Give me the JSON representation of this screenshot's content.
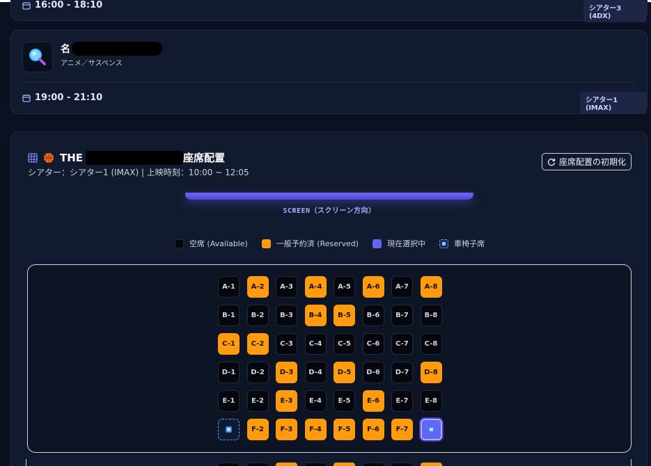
{
  "prev_showtime": {
    "time": "16:00 - 18:10",
    "theater": "シアター3 (4DX)"
  },
  "movie": {
    "icon": "magnifier-icon",
    "title_prefix": "名",
    "genre": "アニメ／サスペンス",
    "showtime": "19:00 - 21:10",
    "theater": "シアター1 (IMAX)"
  },
  "seatmap": {
    "icon_grid": "grid-icon",
    "icon_movie": "basketball-icon",
    "title_prefix": "THE",
    "title_suffix": "座席配置",
    "subtitle": "シアター：シアター1 (IMAX) | 上映時刻：10:00 ~ 12:05",
    "reset_label": "座席配置の初期化",
    "screen_label": "SCREEN（スクリーン方向）",
    "legend": [
      {
        "key": "available",
        "label": "空席 (Available)"
      },
      {
        "key": "reserved",
        "label": "一般予約済 (Reserved)"
      },
      {
        "key": "selected",
        "label": "現在選択中"
      },
      {
        "key": "wheelchair",
        "label": "車椅子席"
      }
    ],
    "colors": {
      "reserved": "#ff9b0f",
      "selected": "#6366f1",
      "available": "#05070d",
      "wheelchair": "#3b82f6"
    },
    "rows": [
      {
        "row": "A",
        "seats": [
          {
            "label": "A-1",
            "status": "available"
          },
          {
            "label": "A-2",
            "status": "reserved"
          },
          {
            "label": "A-3",
            "status": "available"
          },
          {
            "label": "A-4",
            "status": "reserved"
          },
          {
            "label": "A-5",
            "status": "available"
          },
          {
            "label": "A-6",
            "status": "reserved"
          },
          {
            "label": "A-7",
            "status": "available"
          },
          {
            "label": "A-8",
            "status": "reserved"
          }
        ]
      },
      {
        "row": "B",
        "seats": [
          {
            "label": "B-1",
            "status": "available"
          },
          {
            "label": "B-2",
            "status": "available"
          },
          {
            "label": "B-3",
            "status": "available"
          },
          {
            "label": "B-4",
            "status": "reserved"
          },
          {
            "label": "B-5",
            "status": "reserved"
          },
          {
            "label": "B-6",
            "status": "available"
          },
          {
            "label": "B-7",
            "status": "available"
          },
          {
            "label": "B-8",
            "status": "available"
          }
        ]
      },
      {
        "row": "C",
        "seats": [
          {
            "label": "C-1",
            "status": "reserved"
          },
          {
            "label": "C-2",
            "status": "reserved"
          },
          {
            "label": "C-3",
            "status": "available"
          },
          {
            "label": "C-4",
            "status": "available"
          },
          {
            "label": "C-5",
            "status": "available"
          },
          {
            "label": "C-6",
            "status": "available"
          },
          {
            "label": "C-7",
            "status": "available"
          },
          {
            "label": "C-8",
            "status": "available"
          }
        ]
      },
      {
        "row": "D",
        "seats": [
          {
            "label": "D-1",
            "status": "available"
          },
          {
            "label": "D-2",
            "status": "available"
          },
          {
            "label": "D-3",
            "status": "reserved"
          },
          {
            "label": "D-4",
            "status": "available"
          },
          {
            "label": "D-5",
            "status": "reserved"
          },
          {
            "label": "D-6",
            "status": "available"
          },
          {
            "label": "D-7",
            "status": "available"
          },
          {
            "label": "D-8",
            "status": "reserved"
          }
        ]
      },
      {
        "row": "E",
        "seats": [
          {
            "label": "E-1",
            "status": "available"
          },
          {
            "label": "E-2",
            "status": "available"
          },
          {
            "label": "E-3",
            "status": "reserved"
          },
          {
            "label": "E-4",
            "status": "available"
          },
          {
            "label": "E-5",
            "status": "available"
          },
          {
            "label": "E-6",
            "status": "reserved"
          },
          {
            "label": "E-7",
            "status": "available"
          },
          {
            "label": "E-8",
            "status": "available"
          }
        ]
      },
      {
        "row": "F",
        "seats": [
          {
            "label": "",
            "status": "wheelchair"
          },
          {
            "label": "F-2",
            "status": "reserved"
          },
          {
            "label": "F-3",
            "status": "reserved"
          },
          {
            "label": "F-4",
            "status": "reserved"
          },
          {
            "label": "F-5",
            "status": "reserved"
          },
          {
            "label": "F-6",
            "status": "reserved"
          },
          {
            "label": "F-7",
            "status": "reserved"
          },
          {
            "label": "",
            "status": "selected-wheelchair"
          }
        ]
      }
    ],
    "next_row_partial": [
      "available",
      "available",
      "reserved",
      "available",
      "reserved",
      "available",
      "available",
      "reserved"
    ]
  }
}
